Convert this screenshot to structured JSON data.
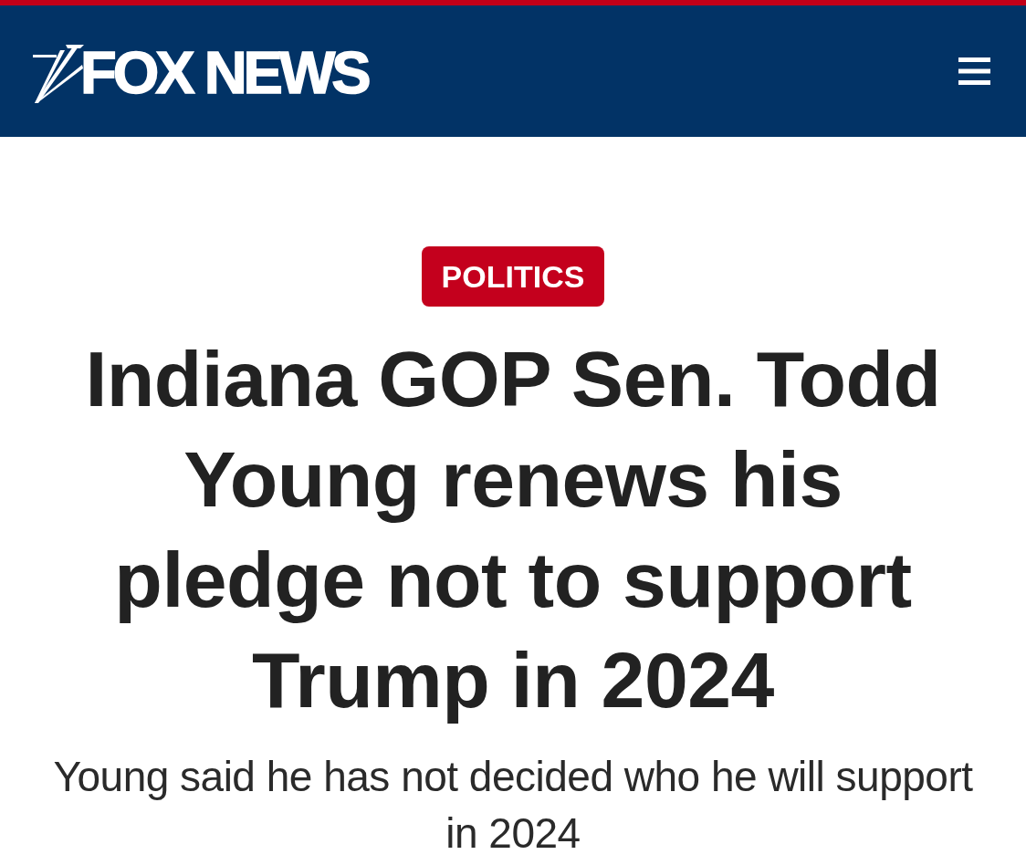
{
  "header": {
    "logo_text": "FOX NEWS"
  },
  "article": {
    "category": "POLITICS",
    "headline": "Indiana GOP Sen. Todd Young renews his pledge not to support Trump in 2024",
    "subheadline": "Young said he has not decided who he will support in 2024"
  }
}
